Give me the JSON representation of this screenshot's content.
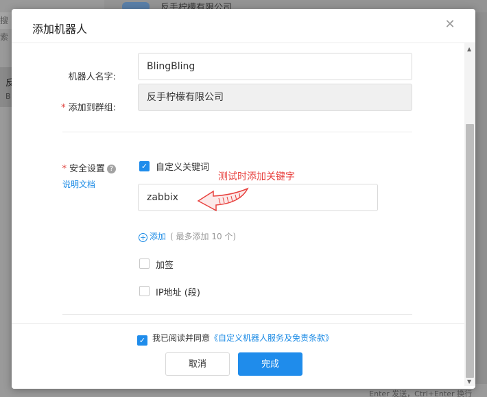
{
  "background": {
    "search_placeholder": "搜索",
    "chat_item_title": "反",
    "chat_item_sub": "B",
    "top_name": "反手柠檬有限公司",
    "bottom_hint": "Enter 发送，Ctrl+Enter 换行"
  },
  "dialog": {
    "title": "添加机器人",
    "close_icon": "close-icon",
    "form": {
      "name_label": "机器人名字:",
      "name_value": "BlingBling",
      "group_label": "添加到群组:",
      "group_value": "反手柠檬有限公司",
      "security_label": "安全设置",
      "security_help": "?",
      "doc_link": "说明文档",
      "custom_keyword_label": "自定义关键词",
      "custom_keyword_checked": true,
      "keyword_value": "zabbix",
      "annotation": "测试时添加关键字",
      "add_label": "添加",
      "add_note": "( 最多添加 10 个)",
      "sign_label": "加签",
      "sign_checked": false,
      "ip_label": "IP地址 (段)",
      "ip_checked": false
    },
    "footer": {
      "agree_text": "我已阅读并同意",
      "agree_link": "《自定义机器人服务及免责条款》",
      "agree_checked": true,
      "cancel_label": "取消",
      "confirm_label": "完成"
    }
  },
  "colors": {
    "accent": "#1f8ceb",
    "required": "#e0433e",
    "annotation": "#e8423f"
  }
}
